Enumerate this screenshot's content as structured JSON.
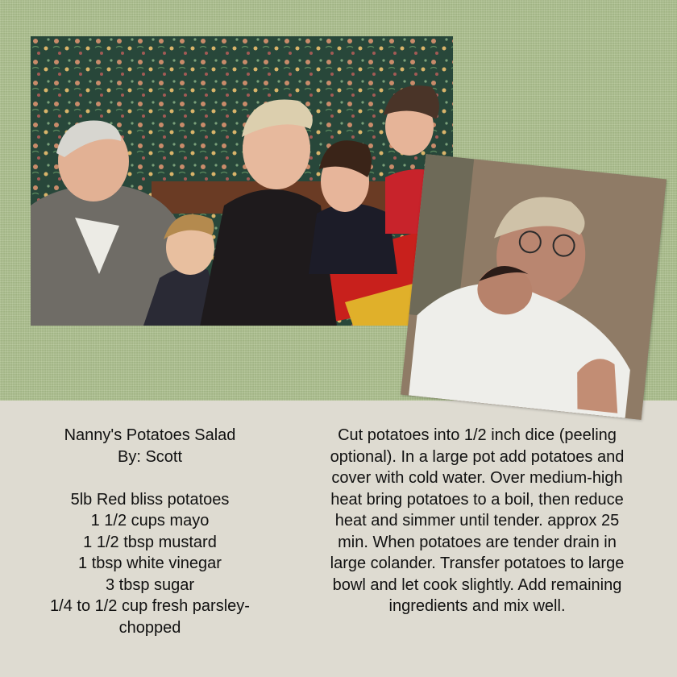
{
  "recipe": {
    "title": "Nanny's Potatoes Salad",
    "byline": "By: Scott",
    "ingredients": [
      "5lb Red bliss potatoes",
      "1 1/2 cups mayo",
      "1 1/2 tbsp mustard",
      "1 tbsp white vinegar",
      "3 tbsp sugar",
      "1/4 to 1/2 cup fresh parsley-",
      "chopped"
    ],
    "directions_lines": [
      "Cut potatoes into 1/2 inch dice (peeling",
      "optional). In a  large pot add potatoes and",
      "cover with cold water. Over medium-high",
      "heat bring potatoes to a boil, then reduce",
      "heat and simmer until tender. approx 25",
      "min. When potatoes are tender drain in",
      "large colander. Transfer potatoes to large",
      "bowl and let cook slightly. Add remaining",
      "ingredients and mix well."
    ]
  },
  "colors": {
    "linen_green": "#a9bd8a",
    "card_beige": "#dedbd1",
    "text": "#111111"
  }
}
